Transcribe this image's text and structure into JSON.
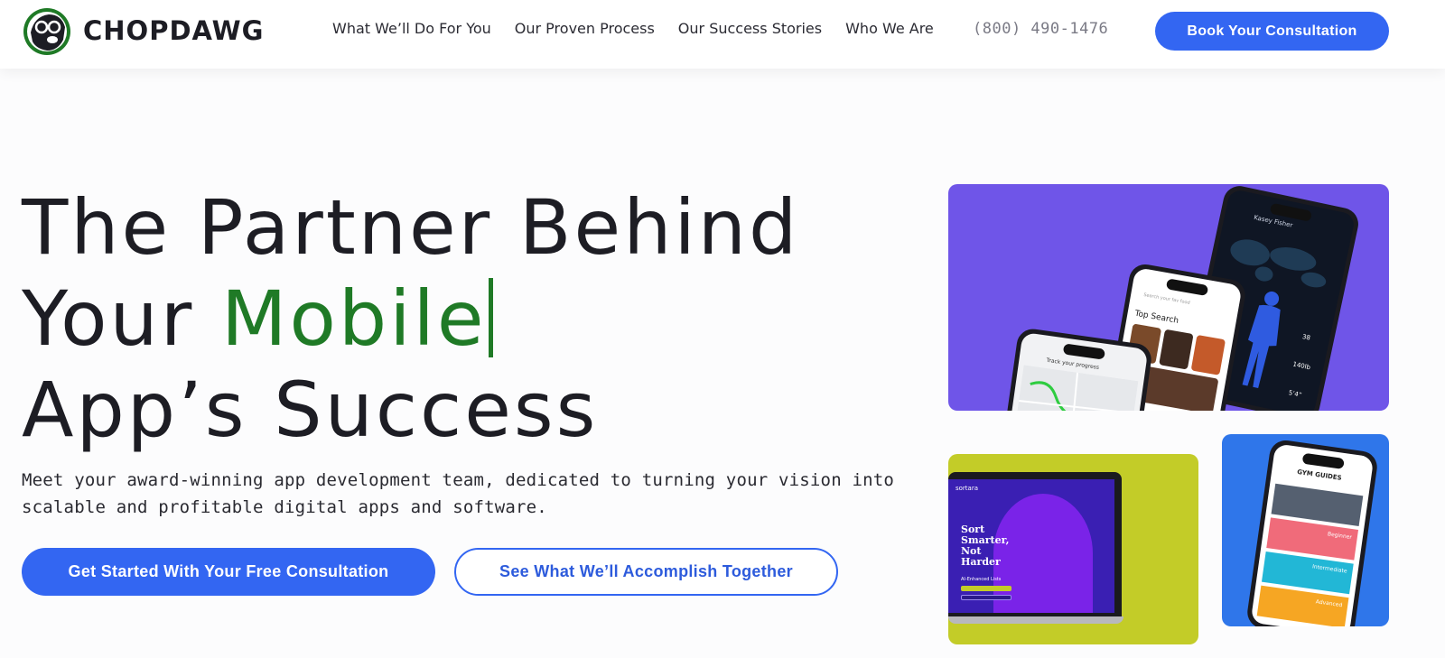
{
  "brand": {
    "name": "CHOPDAWG"
  },
  "nav": {
    "items": [
      {
        "label": "What We’ll Do For You"
      },
      {
        "label": "Our Proven Process"
      },
      {
        "label": "Our Success Stories"
      },
      {
        "label": "Who We Are"
      }
    ],
    "phone": "(800) 490-1476",
    "book_label": "Book Your Consultation"
  },
  "hero": {
    "title_line1": "The Partner Behind",
    "title_line2_prefix": "Your ",
    "title_accent": "Mobile",
    "title_line3": "App’s Success",
    "subtitle": "Meet your award-winning app development team, dedicated to turning your vision into scalable and profitable digital apps and software.",
    "primary_cta": "Get Started With Your Free Consultation",
    "secondary_cta": "See What We’ll Accomplish Together"
  },
  "cards": {
    "fitness": {
      "user": "Kasey Fisher",
      "stat1": "38",
      "stat2": "140lb",
      "stat3": "5’4”"
    },
    "food": {
      "search_placeholder": "Search your fav food",
      "section": "Top Search"
    },
    "map": {
      "label": "Track your progress"
    },
    "laptop": {
      "brand": "sortara",
      "headline": "Sort Smarter, Not Harder",
      "tagline": "AI-Enhanced Lists"
    },
    "gym": {
      "title": "GYM GUIDES",
      "levels": [
        "Beginner",
        "Intermediate",
        "Advanced"
      ]
    }
  },
  "colors": {
    "accent": "#3366f2",
    "brand_green": "#1f7a26",
    "purple_card": "#6f55e8",
    "lime_card": "#c3cc28",
    "blue_card": "#2f76ea"
  }
}
